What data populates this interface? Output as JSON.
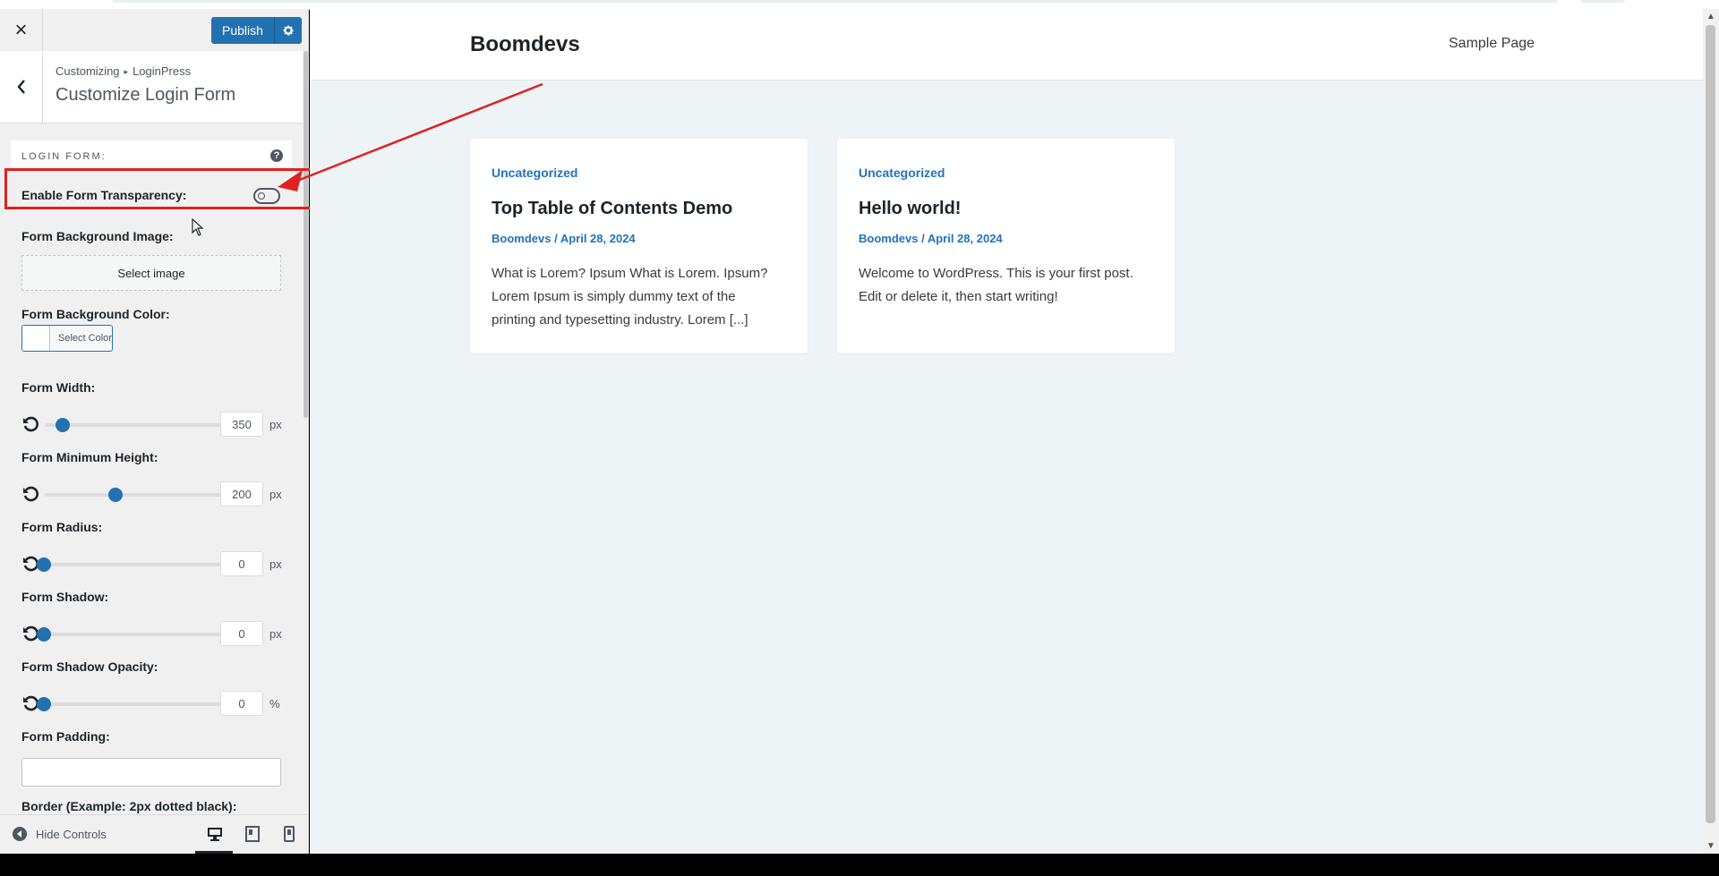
{
  "header": {
    "close_label": "×",
    "publish_label": "Publish"
  },
  "section": {
    "breadcrumb_parent": "Customizing",
    "breadcrumb_child": "LoginPress",
    "title": "Customize Login Form"
  },
  "controls": {
    "group_label": "LOGIN FORM:",
    "help_icon": "?",
    "transparency_label": "Enable Form Transparency:",
    "transparency_enabled": false,
    "bg_image_label": "Form Background Image:",
    "select_image_label": "Select image",
    "bg_color_label": "Form Background Color:",
    "select_color_label": "Select Color",
    "sliders": [
      {
        "label": "Form Width:",
        "value": "350",
        "unit": "px",
        "fraction": 0.1
      },
      {
        "label": "Form Minimum Height:",
        "value": "200",
        "unit": "px",
        "fraction": 0.38
      },
      {
        "label": "Form Radius:",
        "value": "0",
        "unit": "px",
        "fraction": 0.0
      },
      {
        "label": "Form Shadow:",
        "value": "0",
        "unit": "px",
        "fraction": 0.0
      },
      {
        "label": "Form Shadow Opacity:",
        "value": "0",
        "unit": "%",
        "fraction": 0.0
      }
    ],
    "padding_label": "Form Padding:",
    "padding_value": "",
    "border_label": "Border (Example: 2px dotted black):"
  },
  "footer": {
    "hide_controls_label": "Hide Controls",
    "devices": [
      "desktop-icon",
      "tablet-icon",
      "mobile-icon"
    ],
    "active_device": "desktop"
  },
  "preview": {
    "site_title": "Boomdevs",
    "menu_item": "Sample Page",
    "posts": [
      {
        "category": "Uncategorized",
        "title": "Top Table of Contents Demo",
        "author": "Boomdevs",
        "date": "April 28, 2024",
        "excerpt_lines": [
          "What is Lorem? Ipsum What is Lorem. Ipsum?",
          "Lorem Ipsum is simply dummy text of the",
          "printing and typesetting industry. Lorem [...]"
        ]
      },
      {
        "category": "Uncategorized",
        "title": "Hello world!",
        "author": "Boomdevs",
        "date": "April 28, 2024",
        "excerpt_lines": [
          "Welcome to WordPress. This is your first post.",
          "Edit or delete it, then start writing!"
        ]
      }
    ]
  },
  "colors": {
    "accent": "#2271b1",
    "link": "#1e73be",
    "annotation": "#e02020",
    "preview_bg": "#eef3f6"
  }
}
